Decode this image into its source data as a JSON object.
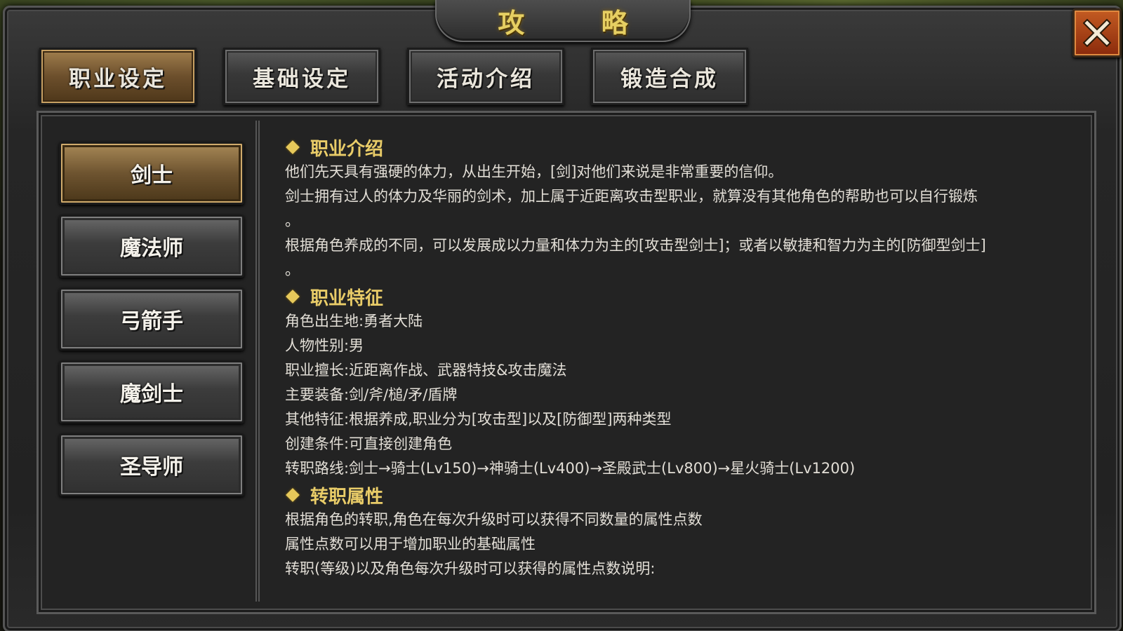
{
  "title": "攻 略",
  "tabs": [
    {
      "label": "职业设定",
      "active": true
    },
    {
      "label": "基础设定",
      "active": false
    },
    {
      "label": "活动介绍",
      "active": false
    },
    {
      "label": "锻造合成",
      "active": false
    }
  ],
  "classes": [
    {
      "label": "剑士",
      "active": true
    },
    {
      "label": "魔法师",
      "active": false
    },
    {
      "label": "弓箭手",
      "active": false
    },
    {
      "label": "魔剑士",
      "active": false
    },
    {
      "label": "圣导师",
      "active": false
    }
  ],
  "sections": {
    "intro": {
      "title": "职业介绍",
      "lines": [
        "他们先天具有强硬的体力，从出生开始，[剑]对他们来说是非常重要的信仰。",
        "剑士拥有过人的体力及华丽的剑术，加上属于近距离攻击型职业，就算没有其他角色的帮助也可以自行锻炼",
        "。",
        "根据角色养成的不同，可以发展成以力量和体力为主的[攻击型剑士]；或者以敏捷和智力为主的[防御型剑士]",
        "。"
      ]
    },
    "features": {
      "title": "职业特征",
      "lines": [
        "角色出生地:勇者大陆",
        "人物性别:男",
        "职业擅长:近距离作战、武器特技&攻击魔法",
        "主要装备:剑/斧/槌/矛/盾牌",
        "其他特征:根据养成,职业分为[攻击型]以及[防御型]两种类型",
        "创建条件:可直接创建角色",
        "转职路线:剑士→骑士(Lv150)→神骑士(Lv400)→圣殿武士(Lv800)→星火骑士(Lv1200)"
      ]
    },
    "attributes": {
      "title": "转职属性",
      "lines": [
        "根据角色的转职,角色在每次升级时可以获得不同数量的属性点数",
        "属性点数可以用于增加职业的基础属性",
        "转职(等级)以及角色每次升级时可以获得的属性点数说明:"
      ]
    }
  },
  "colors": {
    "title_gold": "#e6cf62",
    "section_gold": "#e9cc68",
    "body_text": "#e2ded6",
    "active_bronze": "#6e5430",
    "close_orange": "#c35b22"
  },
  "icons": {
    "close": "close-x-icon",
    "bullet": "diamond-bullet-icon"
  }
}
